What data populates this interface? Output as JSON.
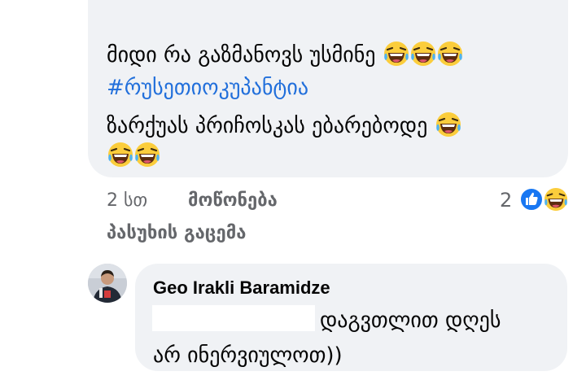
{
  "comment": {
    "line1_text": "მიდი რა გაზმანოვს უსმინე",
    "line1_emoji": [
      "haha-emoji",
      "haha-emoji",
      "haha-emoji"
    ],
    "hashtag": "#რუსეთიოკუპანტია",
    "line3_text": "ზარქუას პრიჩოსკას ებარებოდე",
    "line3_emoji": [
      "haha-emoji"
    ],
    "line4_emoji": [
      "haha-emoji",
      "haha-emoji"
    ],
    "time": "2 სთ",
    "like_label": "მოწონება",
    "reply_label": "პასუხის გაცემა",
    "reaction_count": "2",
    "reactions": [
      "like-reaction-icon",
      "haha-reaction-icon"
    ]
  },
  "reply": {
    "author": "Geo Irakli Baramidze",
    "line1": "დაგვთლით დღეს",
    "line2": "არ ინერვიულოთ))"
  },
  "colors": {
    "bubble": "#f0f2f5",
    "text": "#050505",
    "secondary": "#65676b",
    "hashtag": "#216fdb",
    "like_blue": "#1877f2",
    "emoji_yellow": "#fbcd3c"
  }
}
